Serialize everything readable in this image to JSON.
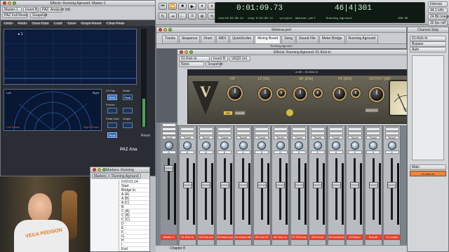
{
  "top_left_window": {
    "title": "Effects: Running Aground: Master-1",
    "preset_select": "Master-1",
    "insert_select": "Insert B",
    "plugin_select": "PAZ: Analyzer (st)",
    "preset_name": "PAZ Full Reset",
    "snapshot_label": "Snapshot",
    "toolbar": [
      "Undo",
      "Redo",
      "Save Data",
      "Load",
      "Save",
      "Graph Reset",
      "Clear Peak"
    ],
    "analyzer_label": "▸ 1",
    "position_left": "Left",
    "position_right": "Right",
    "position_left_bottom": "Left Phase",
    "position_right_bottom": "Right Phase",
    "controls": [
      "LR Pan",
      "Width",
      "RMS",
      "Peak",
      "Freeze",
      "Peak Hold",
      "Graph",
      "Zoom",
      "Reset"
    ],
    "brand": "PAZ Ana"
  },
  "transport": {
    "main_counter": "0:01:09.73",
    "bars_beats": "46|4|301",
    "start_label": "start",
    "start_value": "0:02:08.11",
    "end_label": "stop",
    "end_value": "0:02:08.11",
    "project_label": "~project: Webinar.perf",
    "song_label": "Running Aground",
    "tempo": "108.00",
    "sync": "Internal",
    "sample_rate": "44.1 kHz",
    "bit_depth": "24 Bit Integer",
    "fps": "30 fps ndf"
  },
  "main_window": {
    "title": "Webinar.perf",
    "tabs": [
      "Tracks",
      "Sequence",
      "Drum",
      "MIDI",
      "QuickScribe",
      "Mixing Board",
      "Song",
      "Sound File",
      "Meter Bridge",
      "Running Aground"
    ],
    "active_tab": "Mixing Board",
    "subtitle": "Running Aground"
  },
  "plugin_window": {
    "title": "Effects: Running Aground: 01-Kick-In",
    "preset_select": "01-Kick-In",
    "insert_select": "Insert B",
    "plugin_select": "VEQ3 (m)",
    "preset_name": "None",
    "snapshot_label": "Snapshot",
    "header_title": "a-m0 -: 01-Kick-In",
    "logo": "V",
    "hp_label": "HP",
    "lf_label": "LF [Hz]",
    "mf_label": "MF [kHz]",
    "hf_label": "HF [kHz]",
    "output_label": "OUTPUT [dB]",
    "on_button": "ON",
    "phase_button": "PHASE",
    "analog_button": "ANALOG",
    "meter_label": "VU"
  },
  "mixer": {
    "channels": [
      {
        "name": "Master-1",
        "pan": "0",
        "vol": "-inf"
      },
      {
        "name": "01-Kick-In",
        "pan": "0",
        "vol": "0"
      },
      {
        "name": "02-Kick-out",
        "pan": "0",
        "vol": "0"
      },
      {
        "name": "03-Snare-top",
        "pan": "0",
        "vol": "0"
      },
      {
        "name": "04-Snare-btm",
        "pan": "0",
        "vol": "0"
      },
      {
        "name": "05-Tom-Hi",
        "pan": "0",
        "vol": "0"
      },
      {
        "name": "06-Tom-Lo",
        "pan": "0",
        "vol": "0"
      },
      {
        "name": "07-Tom-low",
        "pan": "0",
        "vol": "0"
      },
      {
        "name": "08-Hi-hat",
        "pan": "0",
        "vol": "0"
      },
      {
        "name": "09-Overhead",
        "pan": "0",
        "vol": "0"
      },
      {
        "name": "10-Room",
        "pan": "0",
        "vol": "0"
      },
      {
        "name": "Bus-kit",
        "pan": "0",
        "vol": "0"
      },
      {
        "name": "11-Loops",
        "pan": "0",
        "vol": "0"
      }
    ],
    "bottom_bar": "Chapter 8"
  },
  "markers": {
    "title": "Markers: Running",
    "tabs": [
      "Markers",
      "Running Aground"
    ],
    "rows": [
      "0:00:01.14",
      "Start",
      "Bridge In",
      "A (A)",
      "A (B)",
      "A (C)",
      "B",
      "C (A)",
      "C (B)",
      "C (C)",
      "D",
      "E",
      "F",
      "G",
      "H",
      "I",
      "End"
    ]
  },
  "right_panel": {
    "title": "Channel Strip",
    "select": "01-Kick-In",
    "auto": "Auto",
    "route_button": "Bypass",
    "output": "Main",
    "bus_button": "01-Kick-In"
  },
  "presenter": {
    "shirt_text": "VEGA PEDISON"
  }
}
